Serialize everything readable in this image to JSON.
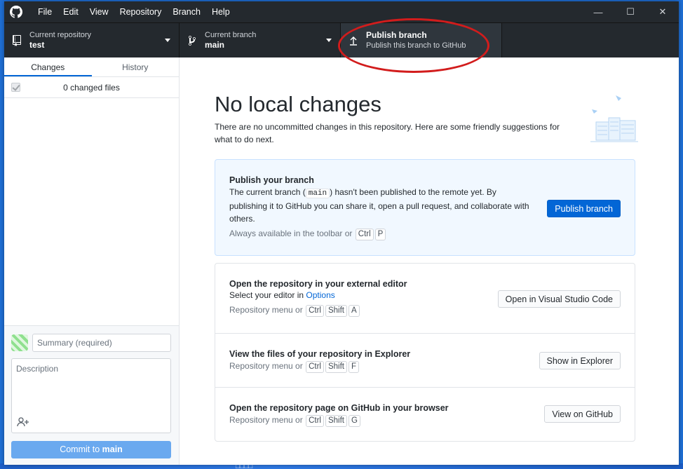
{
  "menu": [
    "File",
    "Edit",
    "View",
    "Repository",
    "Branch",
    "Help"
  ],
  "window_controls": {
    "minimize": "—",
    "maximize": "☐",
    "close": "✕"
  },
  "toolbar": {
    "repo_label": "Current repository",
    "repo_value": "test",
    "branch_label": "Current branch",
    "branch_value": "main",
    "publish_title": "Publish branch",
    "publish_subtitle": "Publish this branch to GitHub"
  },
  "sidebar": {
    "tabs": [
      "Changes",
      "History"
    ],
    "changed_files": "0 changed files",
    "summary_placeholder": "Summary (required)",
    "description_placeholder": "Description",
    "commit_prefix": "Commit to",
    "commit_branch": "main"
  },
  "main": {
    "title": "No local changes",
    "subtitle": "There are no uncommitted changes in this repository. Here are some friendly suggestions for what to do next.",
    "publish_card": {
      "title": "Publish your branch",
      "body_1": "The current branch (",
      "branch_code": "main",
      "body_2": ") hasn't been published to the remote yet. By publishing it to GitHub you can share it, open a pull request, and collaborate with others.",
      "hint": "Always available in the toolbar or",
      "keys": [
        "Ctrl",
        "P"
      ],
      "button": "Publish branch"
    },
    "editor_card": {
      "title": "Open the repository in your external editor",
      "body": "Select your editor in",
      "link": "Options",
      "hint": "Repository menu or",
      "keys": [
        "Ctrl",
        "Shift",
        "A"
      ],
      "button": "Open in Visual Studio Code"
    },
    "explorer_card": {
      "title": "View the files of your repository in Explorer",
      "hint": "Repository menu or",
      "keys": [
        "Ctrl",
        "Shift",
        "F"
      ],
      "button": "Show in Explorer"
    },
    "github_card": {
      "title": "Open the repository page on GitHub in your browser",
      "hint": "Repository menu or",
      "keys": [
        "Ctrl",
        "Shift",
        "G"
      ],
      "button": "View on GitHub"
    }
  },
  "colors": {
    "toolbar_bg": "#24292e",
    "primary": "#0366d6",
    "annotation": "#d21c1c"
  }
}
